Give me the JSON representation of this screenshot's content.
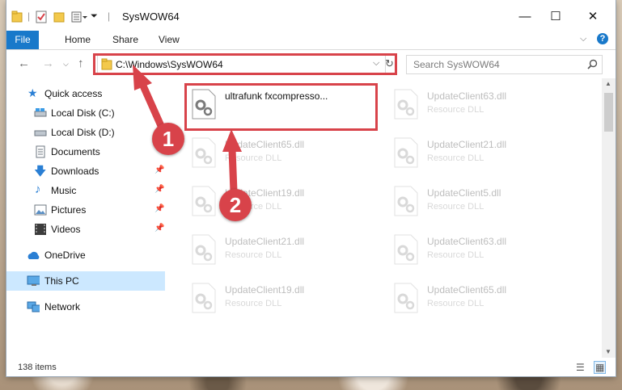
{
  "window": {
    "title": "SysWOW64",
    "controls": {
      "minimize": "—",
      "maximize": "☐",
      "close": "✕"
    }
  },
  "ribbon": {
    "tabs": [
      "File",
      "Home",
      "Share",
      "View"
    ],
    "help": "?"
  },
  "address": {
    "path": "C:\\Windows\\SysWOW64",
    "search_placeholder": "Search SysWOW64"
  },
  "nav": {
    "quick_access": "Quick access",
    "local_c": "Local Disk (C:)",
    "local_d": "Local Disk (D:)",
    "documents": "Documents",
    "downloads": "Downloads",
    "music": "Music",
    "pictures": "Pictures",
    "videos": "Videos",
    "onedrive": "OneDrive",
    "this_pc": "This PC",
    "network": "Network"
  },
  "files": [
    {
      "name": "ultrafunk fxcompresso...",
      "type": ""
    },
    {
      "name": "UpdateClient63.dll",
      "type": "Resource DLL"
    },
    {
      "name": "UpdateClient65.dll",
      "type": "Resource DLL"
    },
    {
      "name": "UpdateClient21.dll",
      "type": "Resource DLL"
    },
    {
      "name": "UpdateClient19.dll",
      "type": "Resource DLL"
    },
    {
      "name": "UpdateClient5.dll",
      "type": "Resource DLL"
    },
    {
      "name": "UpdateClient21.dll",
      "type": "Resource DLL"
    },
    {
      "name": "UpdateClient63.dll",
      "type": "Resource DLL"
    },
    {
      "name": "UpdateClient19.dll",
      "type": "Resource DLL"
    },
    {
      "name": "UpdateClient65.dll",
      "type": "Resource DLL"
    }
  ],
  "status": {
    "items": "138 items"
  },
  "annotations": {
    "step1": "1",
    "step2": "2"
  },
  "colors": {
    "accent": "#1979ca",
    "annotation": "#d8434a",
    "selection": "#cce8ff"
  }
}
